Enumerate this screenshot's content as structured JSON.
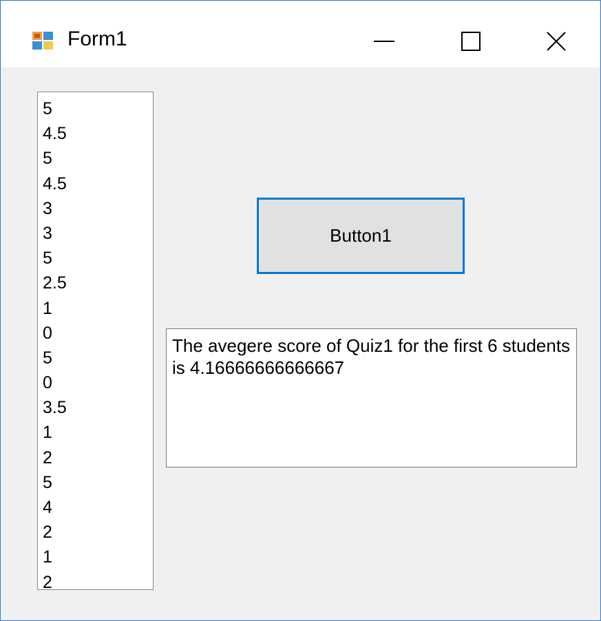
{
  "window": {
    "title": "Form1",
    "icon": "windows-form-icon",
    "controls": [
      "minimize-icon",
      "maximize-icon",
      "close-icon"
    ],
    "accent_color": "#2b7bd8"
  },
  "listbox": {
    "items": [
      "5",
      "4.5",
      "5",
      "4.5",
      "3",
      "3",
      "5",
      "2.5",
      "1",
      "0",
      "5",
      "0",
      "3.5",
      "1",
      "2",
      "5",
      "4",
      "2",
      "1",
      "2"
    ]
  },
  "button1": {
    "label": "Button1"
  },
  "output": {
    "text": "The avegere score of Quiz1 for the first 6 students is 4.16666666666667"
  }
}
